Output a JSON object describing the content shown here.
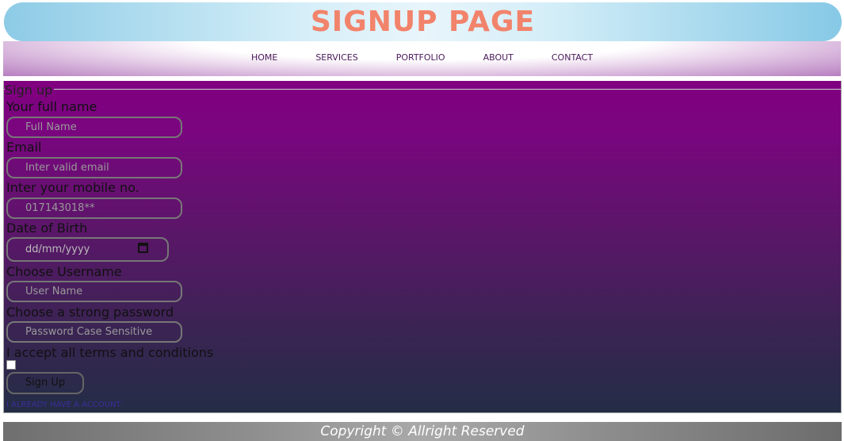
{
  "header": {
    "title": "SIGNUP PAGE"
  },
  "nav": {
    "items": [
      {
        "label": "HOME"
      },
      {
        "label": "SERVICES"
      },
      {
        "label": "PORTFOLIO"
      },
      {
        "label": "ABOUT"
      },
      {
        "label": "CONTACT"
      }
    ]
  },
  "form": {
    "legend": "Sign up",
    "fullname": {
      "label": "Your full name",
      "placeholder": "Full Name"
    },
    "email": {
      "label": "Email",
      "placeholder": "Inter valid email"
    },
    "mobile": {
      "label": "Inter your mobile no.",
      "placeholder": "017143018**"
    },
    "dob": {
      "label": "Date of Birth",
      "placeholder": "dd/mm/yyyy"
    },
    "username": {
      "label": "Choose Username",
      "placeholder": "User Name"
    },
    "password": {
      "label": "Choose a strong password",
      "placeholder": "Password Case Sensitive"
    },
    "terms": {
      "label": "I accept all terms and conditions",
      "checked": false
    },
    "submit_label": "Sign Up",
    "already_link": "I ALREADY HAVE A ACCOUNT"
  },
  "footer": {
    "text": "Copyright © Allright Reserved"
  },
  "colors": {
    "title": "#f2836b",
    "header_gradient": "#8dcbe6",
    "panel_top": "#800080",
    "panel_bottom": "#232d46",
    "link": "#3b2d9a"
  }
}
